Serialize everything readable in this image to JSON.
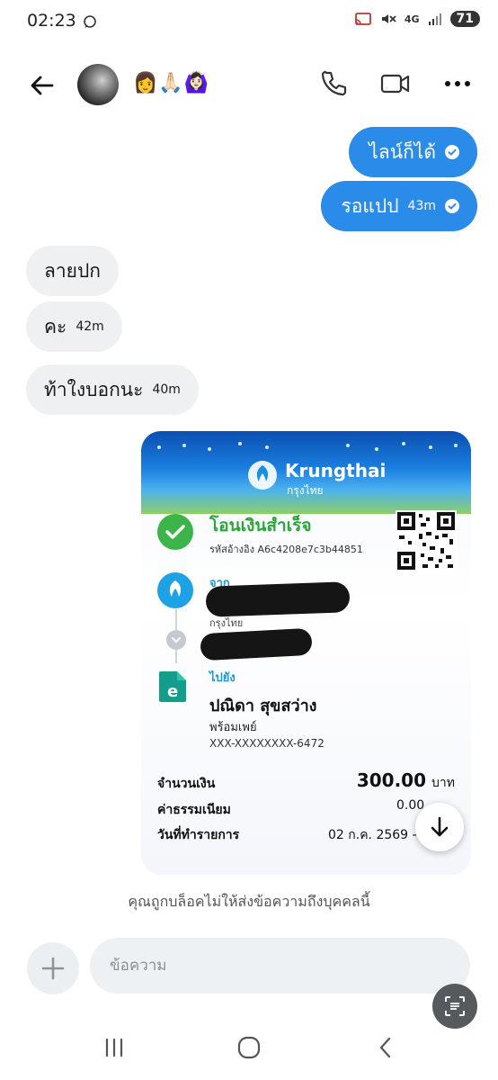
{
  "status_bar": {
    "time": "02:23",
    "network": "4G",
    "battery": "71"
  },
  "header": {
    "contact_emojis": "👩🙏🏻🙆🏻‍♀️",
    "icons": [
      "back-arrow-icon",
      "phone-icon",
      "video-icon",
      "more-icon"
    ]
  },
  "messages": {
    "outgoing": [
      {
        "text": "ไลน์ก็ได้",
        "time": ""
      },
      {
        "text": "รอแปป",
        "time": "43m"
      }
    ],
    "incoming": [
      {
        "text": "ลายปก",
        "time": ""
      },
      {
        "text": "คะ",
        "time": "42m"
      },
      {
        "text": "ท้าใงบอกนะ",
        "time": "40m"
      }
    ]
  },
  "receipt": {
    "bank_name": "Krungthai",
    "bank_name_thai": "กรุงไทย",
    "status": "โอนเงินสำเร็จ",
    "reference": "รหัสอ้างอิง A6c4208e7c3b44851",
    "from_label": "จาก",
    "from_bank": "กรุงไทย",
    "to_label": "ไปยัง",
    "to_name": "ปณิดา สุขสว่าง",
    "to_service": "พร้อมเพย์",
    "to_account": "XXX-XXXXXXXX-6472",
    "amount_label": "จำนวนเงิน",
    "amount": "300.00",
    "currency": "บาท",
    "fee_label": "ค่าธรรมเนียม",
    "fee": "0.00",
    "date_label": "วันที่ทำรายการ",
    "date": "02 ก.ค. 2569 -"
  },
  "footer": {
    "blocked_notice": "คุณถูกบล็อคไม่ให้ส่งข้อความถึงบุคคลนี้",
    "input_placeholder": "ข้อความ"
  },
  "colors": {
    "outgoing_bubble": "#2a8be8",
    "incoming_bubble": "#eef0f2",
    "success": "#3bb54a",
    "bank_blue": "#1ea2e6"
  }
}
